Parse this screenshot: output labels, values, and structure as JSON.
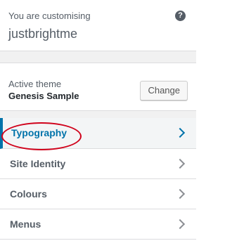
{
  "header": {
    "subtitle": "You are customising",
    "site_name": "justbrightme",
    "help_glyph": "?"
  },
  "theme": {
    "label": "Active theme",
    "name": "Genesis Sample",
    "change_label": "Change"
  },
  "menu": {
    "items": [
      {
        "label": "Typography",
        "active": true
      },
      {
        "label": "Site Identity"
      },
      {
        "label": "Colours"
      },
      {
        "label": "Menus"
      }
    ]
  },
  "annotation": {
    "shape": "oval",
    "color": "#d0021b"
  },
  "colors": {
    "accent": "#0073aa",
    "panel_bg": "#f1f1f1"
  }
}
